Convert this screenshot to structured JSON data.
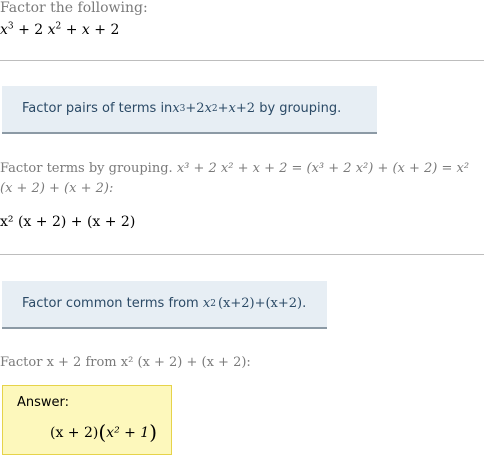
{
  "prompt": "Factor the following:",
  "problem": {
    "x": "x",
    "exp3": "3",
    "plus2": " + 2 ",
    "x2": "x",
    "exp2": "2",
    "tail1": " + ",
    "x3": "x",
    "tail2": " + 2"
  },
  "hint1": {
    "before": "Factor pairs of terms in ",
    "expr_x": "x",
    "expr_e3": "3",
    "expr_mid": "+2",
    "expr_x2": "x",
    "expr_e2": "2",
    "expr_plus": "+",
    "expr_x3": "x",
    "expr_end": "+2",
    "after": " by grouping."
  },
  "step1": {
    "line1_text": "Factor terms by grouping. ",
    "line1_math": "x³ + 2 x² + x + 2 = (x³ + 2 x²) + (x + 2) = x²",
    "line2_math": "(x + 2) + (x + 2):",
    "result": "x² (x + 2) + (x + 2)"
  },
  "hint2": {
    "before": "Factor common terms from ",
    "expr_x": "x",
    "expr_e2": "2",
    "expr_rest": "(x+2)+(x+2).",
    "after": ""
  },
  "step2": {
    "text": "Factor x + 2 from x² (x + 2) + (x + 2):"
  },
  "answer": {
    "label": "Answer:",
    "left": "(x + 2)",
    "inner": "x² + 1"
  }
}
